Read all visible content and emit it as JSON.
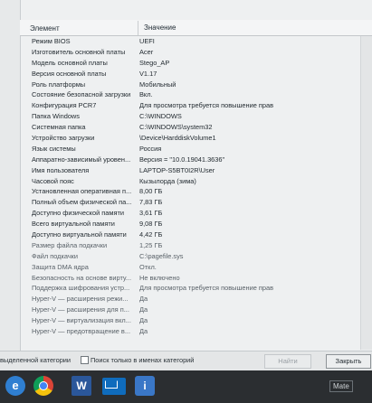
{
  "header": {
    "col_element": "Элемент",
    "col_value": "Значение"
  },
  "rows": [
    {
      "k": "Режим BIOS",
      "v": "UEFI"
    },
    {
      "k": "Изготовитель основной платы",
      "v": "Acer"
    },
    {
      "k": "Модель основной платы",
      "v": "Stego_AP"
    },
    {
      "k": "Версия основной платы",
      "v": "V1.17"
    },
    {
      "k": "Роль платформы",
      "v": "Мобильный"
    },
    {
      "k": "Состояние безопасной загрузки",
      "v": "Вкл."
    },
    {
      "k": "Конфигурация PCR7",
      "v": "Для просмотра требуется повышение прав"
    },
    {
      "k": "Папка Windows",
      "v": "C:\\WINDOWS"
    },
    {
      "k": "Системная папка",
      "v": "C:\\WINDOWS\\system32"
    },
    {
      "k": "Устройство загрузки",
      "v": "\\Device\\HarddiskVolume1"
    },
    {
      "k": "Язык системы",
      "v": "Россия"
    },
    {
      "k": "Аппаратно-зависимый уровен...",
      "v": "Версия = \"10.0.19041.3636\""
    },
    {
      "k": "Имя пользователя",
      "v": "LAPTOP-S5BT0I2R\\User"
    },
    {
      "k": "Часовой пояс",
      "v": "Кызылорда (зима)"
    },
    {
      "k": "Установленная оперативная п...",
      "v": "8,00 ГБ"
    },
    {
      "k": "Полный объем физической па...",
      "v": "7,83 ГБ"
    },
    {
      "k": "Доступно физической памяти",
      "v": "3,61 ГБ"
    },
    {
      "k": "Всего виртуальной памяти",
      "v": "9,08 ГБ"
    },
    {
      "k": "Доступно виртуальной памяти",
      "v": "4,42 ГБ"
    },
    {
      "k": "Размер файла подкачки",
      "v": "1,25 ГБ"
    },
    {
      "k": "Файл подкачки",
      "v": "C:\\pagefile.sys"
    },
    {
      "k": "Защита DMA ядра",
      "v": "Откл."
    },
    {
      "k": "Безопасность на основе вирту...",
      "v": "Не включено"
    },
    {
      "k": "Поддержка шифрования устр...",
      "v": "Для просмотра требуется повышение прав"
    },
    {
      "k": "Hyper-V — расширения режи...",
      "v": "Да"
    },
    {
      "k": "Hyper-V — расширения для п...",
      "v": "Да"
    },
    {
      "k": "Hyper-V — виртуализация вкл...",
      "v": "Да"
    },
    {
      "k": "Hyper-V — предотвращение в...",
      "v": "Да"
    }
  ],
  "bottom": {
    "search_selected_label": "выделенной категории",
    "search_names_label": "Поиск только в именах категорий",
    "find_button": "Найти",
    "close_button": "Закрыть"
  },
  "taskbar": {
    "ie_glyph": "e",
    "word_glyph": "W",
    "info_glyph": "i",
    "right_text": "Mate"
  }
}
